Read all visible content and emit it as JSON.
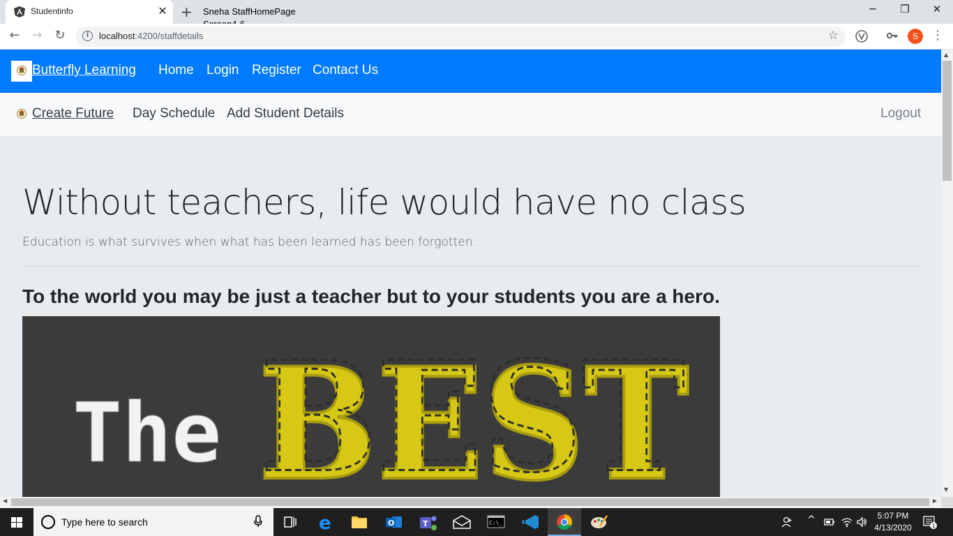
{
  "browser": {
    "tab_title": "Studentinfo",
    "tab_close": "✕",
    "new_tab": "+",
    "tooltip_title": "Sneha StaffHomePage",
    "tooltip_sub": "Screen4-6",
    "url_host": "localhost",
    "url_path": ":4200/staffdetails",
    "profile_initial": "S",
    "back": "←",
    "forward": "→",
    "reload": "↻",
    "star": "☆",
    "menu": "⋮",
    "minimize": "─",
    "restore": "❐",
    "close": "✕"
  },
  "navbar_primary": {
    "brand": "Butterfly Learning",
    "links": [
      "Home",
      "Login",
      "Register",
      "Contact Us"
    ],
    "bg_color": "#007bff"
  },
  "navbar_secondary": {
    "brand": "Create Future",
    "links": [
      "Day Schedule",
      "Add Student Details"
    ],
    "logout": "Logout"
  },
  "jumbotron": {
    "heading": "Without teachers, life would have no class",
    "lead": "Education is what survives when what has been learned has been forgotten.",
    "subheading": "To the world you may be just a teacher but to your students you are a hero.",
    "banner_text_left": "The",
    "banner_text_right": "BEST"
  },
  "taskbar": {
    "search_placeholder": "Type here to search",
    "time": "5:07 PM",
    "date": "4/13/2020",
    "notification_count": "1"
  }
}
